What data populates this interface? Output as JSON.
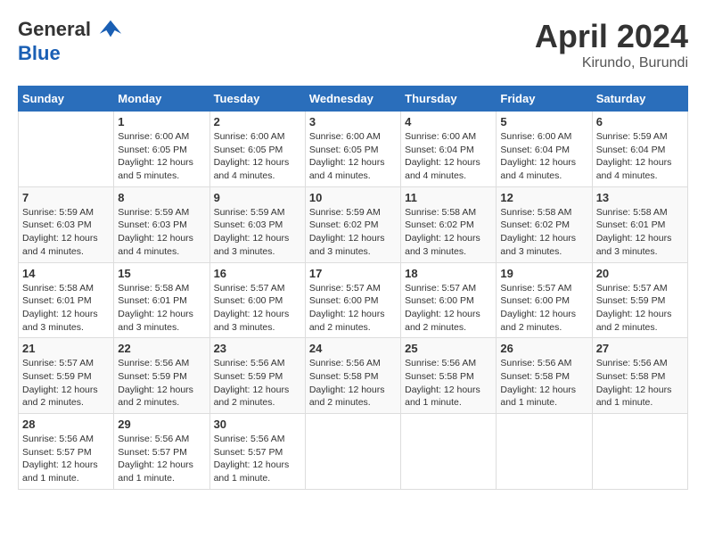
{
  "logo": {
    "line1": "General",
    "line2": "Blue"
  },
  "title": "April 2024",
  "subtitle": "Kirundo, Burundi",
  "header_days": [
    "Sunday",
    "Monday",
    "Tuesday",
    "Wednesday",
    "Thursday",
    "Friday",
    "Saturday"
  ],
  "weeks": [
    [
      {
        "day": "",
        "info": ""
      },
      {
        "day": "1",
        "info": "Sunrise: 6:00 AM\nSunset: 6:05 PM\nDaylight: 12 hours\nand 5 minutes."
      },
      {
        "day": "2",
        "info": "Sunrise: 6:00 AM\nSunset: 6:05 PM\nDaylight: 12 hours\nand 4 minutes."
      },
      {
        "day": "3",
        "info": "Sunrise: 6:00 AM\nSunset: 6:05 PM\nDaylight: 12 hours\nand 4 minutes."
      },
      {
        "day": "4",
        "info": "Sunrise: 6:00 AM\nSunset: 6:04 PM\nDaylight: 12 hours\nand 4 minutes."
      },
      {
        "day": "5",
        "info": "Sunrise: 6:00 AM\nSunset: 6:04 PM\nDaylight: 12 hours\nand 4 minutes."
      },
      {
        "day": "6",
        "info": "Sunrise: 5:59 AM\nSunset: 6:04 PM\nDaylight: 12 hours\nand 4 minutes."
      }
    ],
    [
      {
        "day": "7",
        "info": "Sunrise: 5:59 AM\nSunset: 6:03 PM\nDaylight: 12 hours\nand 4 minutes."
      },
      {
        "day": "8",
        "info": "Sunrise: 5:59 AM\nSunset: 6:03 PM\nDaylight: 12 hours\nand 4 minutes."
      },
      {
        "day": "9",
        "info": "Sunrise: 5:59 AM\nSunset: 6:03 PM\nDaylight: 12 hours\nand 3 minutes."
      },
      {
        "day": "10",
        "info": "Sunrise: 5:59 AM\nSunset: 6:02 PM\nDaylight: 12 hours\nand 3 minutes."
      },
      {
        "day": "11",
        "info": "Sunrise: 5:58 AM\nSunset: 6:02 PM\nDaylight: 12 hours\nand 3 minutes."
      },
      {
        "day": "12",
        "info": "Sunrise: 5:58 AM\nSunset: 6:02 PM\nDaylight: 12 hours\nand 3 minutes."
      },
      {
        "day": "13",
        "info": "Sunrise: 5:58 AM\nSunset: 6:01 PM\nDaylight: 12 hours\nand 3 minutes."
      }
    ],
    [
      {
        "day": "14",
        "info": "Sunrise: 5:58 AM\nSunset: 6:01 PM\nDaylight: 12 hours\nand 3 minutes."
      },
      {
        "day": "15",
        "info": "Sunrise: 5:58 AM\nSunset: 6:01 PM\nDaylight: 12 hours\nand 3 minutes."
      },
      {
        "day": "16",
        "info": "Sunrise: 5:57 AM\nSunset: 6:00 PM\nDaylight: 12 hours\nand 3 minutes."
      },
      {
        "day": "17",
        "info": "Sunrise: 5:57 AM\nSunset: 6:00 PM\nDaylight: 12 hours\nand 2 minutes."
      },
      {
        "day": "18",
        "info": "Sunrise: 5:57 AM\nSunset: 6:00 PM\nDaylight: 12 hours\nand 2 minutes."
      },
      {
        "day": "19",
        "info": "Sunrise: 5:57 AM\nSunset: 6:00 PM\nDaylight: 12 hours\nand 2 minutes."
      },
      {
        "day": "20",
        "info": "Sunrise: 5:57 AM\nSunset: 5:59 PM\nDaylight: 12 hours\nand 2 minutes."
      }
    ],
    [
      {
        "day": "21",
        "info": "Sunrise: 5:57 AM\nSunset: 5:59 PM\nDaylight: 12 hours\nand 2 minutes."
      },
      {
        "day": "22",
        "info": "Sunrise: 5:56 AM\nSunset: 5:59 PM\nDaylight: 12 hours\nand 2 minutes."
      },
      {
        "day": "23",
        "info": "Sunrise: 5:56 AM\nSunset: 5:59 PM\nDaylight: 12 hours\nand 2 minutes."
      },
      {
        "day": "24",
        "info": "Sunrise: 5:56 AM\nSunset: 5:58 PM\nDaylight: 12 hours\nand 2 minutes."
      },
      {
        "day": "25",
        "info": "Sunrise: 5:56 AM\nSunset: 5:58 PM\nDaylight: 12 hours\nand 1 minute."
      },
      {
        "day": "26",
        "info": "Sunrise: 5:56 AM\nSunset: 5:58 PM\nDaylight: 12 hours\nand 1 minute."
      },
      {
        "day": "27",
        "info": "Sunrise: 5:56 AM\nSunset: 5:58 PM\nDaylight: 12 hours\nand 1 minute."
      }
    ],
    [
      {
        "day": "28",
        "info": "Sunrise: 5:56 AM\nSunset: 5:57 PM\nDaylight: 12 hours\nand 1 minute."
      },
      {
        "day": "29",
        "info": "Sunrise: 5:56 AM\nSunset: 5:57 PM\nDaylight: 12 hours\nand 1 minute."
      },
      {
        "day": "30",
        "info": "Sunrise: 5:56 AM\nSunset: 5:57 PM\nDaylight: 12 hours\nand 1 minute."
      },
      {
        "day": "",
        "info": ""
      },
      {
        "day": "",
        "info": ""
      },
      {
        "day": "",
        "info": ""
      },
      {
        "day": "",
        "info": ""
      }
    ]
  ]
}
